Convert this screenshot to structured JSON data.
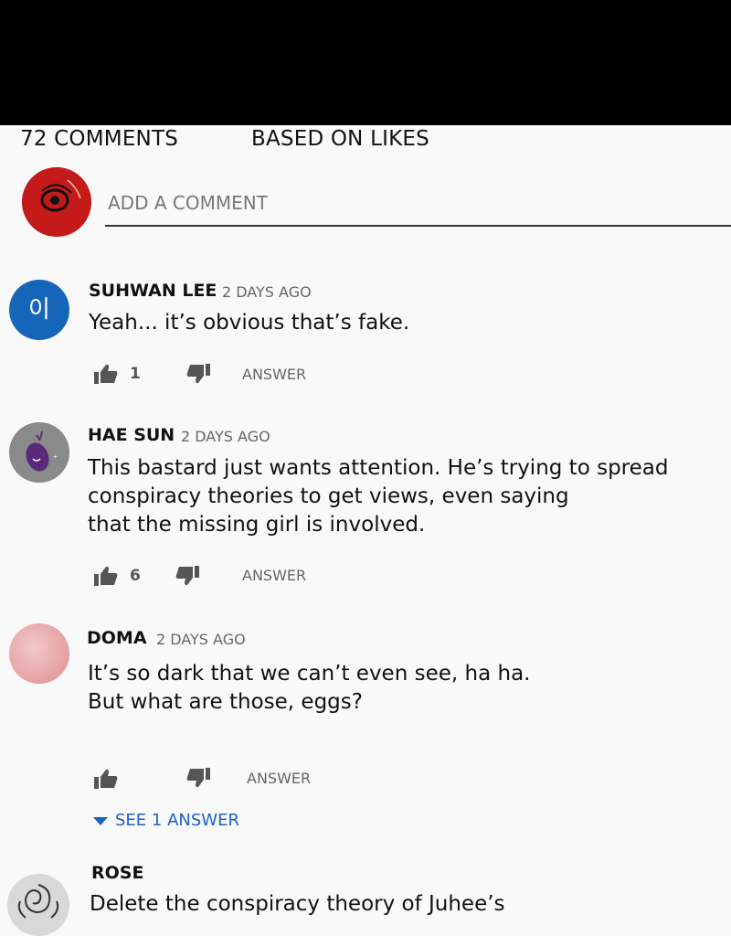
{
  "header": {
    "comment_count": "72 COMMENTS",
    "sort": "BASED ON LIKES"
  },
  "compose": {
    "placeholder": "ADD A COMMENT"
  },
  "comments": [
    {
      "author": "SUHWAN LEE",
      "time": "2 DAYS AGO",
      "text": "Yeah... it’s obvious that’s fake.",
      "likes": "1",
      "answer": "ANSWER",
      "avatar_letter": "이"
    },
    {
      "author": "HAE SUN",
      "time": "2 DAYS AGO",
      "text": "This bastard just wants attention. He’s trying to spread\nconspiracy theories to get views, even saying\nthat the missing girl is involved.",
      "likes": "6",
      "answer": "ANSWER"
    },
    {
      "author": "DOMA",
      "time": "2 DAYS AGO",
      "text": "It’s so dark that we can’t even see, ha ha.\nBut what are those, eggs?",
      "likes": "",
      "answer": "ANSWER",
      "replies": "SEE 1 ANSWER"
    },
    {
      "author": "ROSE",
      "text": "Delete the conspiracy theory of Juhee’s"
    }
  ],
  "colors": {
    "link": "#1a63c0",
    "avatar_blue": "#1565b8",
    "avatar_red": "#c41a1a"
  }
}
